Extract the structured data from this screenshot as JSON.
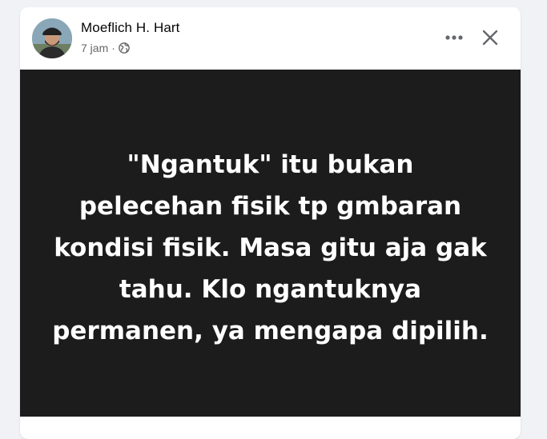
{
  "post": {
    "author": {
      "name": "Moeflich H. Hart",
      "avatar_icon": "person-avatar-icon"
    },
    "meta": {
      "time": "7 jam",
      "separator": "·",
      "audience_icon": "globe-icon"
    },
    "actions": {
      "more_icon": "more-horizontal-icon",
      "close_icon": "close-icon"
    },
    "content": {
      "text": "\"Ngantuk\" itu bukan\npelecehan fisik tp gmbaran\nkondisi fisik. Masa gitu aja gak\ntahu. Klo ngantuknya\npermanen, ya mengapa dipilih.",
      "background_color": "#1c1c1c",
      "text_color": "#ffffff"
    }
  },
  "colors": {
    "page_background": "#f0f2f5",
    "card_background": "#ffffff",
    "name_text": "#050505",
    "secondary_text": "#65676b"
  }
}
